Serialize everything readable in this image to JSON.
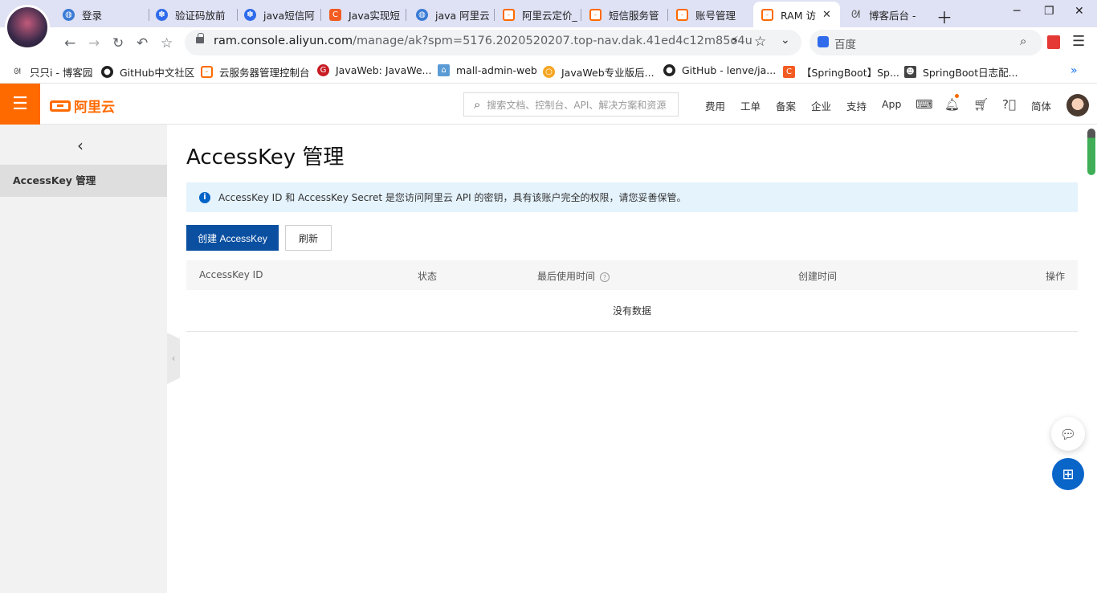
{
  "browser": {
    "tabs": [
      {
        "label": "登录",
        "icon": "globe-icon"
      },
      {
        "label": "验证码放前",
        "icon": "paw-icon"
      },
      {
        "label": "java短信阿",
        "icon": "paw-icon"
      },
      {
        "label": "Java实现短",
        "icon": "csdn-icon"
      },
      {
        "label": "java 阿里云",
        "icon": "globe-icon"
      },
      {
        "label": "阿里云定价_",
        "icon": "aliyun-icon"
      },
      {
        "label": "短信服务管",
        "icon": "aliyun-icon"
      },
      {
        "label": "账号管理",
        "icon": "aliyun-icon"
      },
      {
        "label": "RAM 访",
        "icon": "aliyun-icon"
      },
      {
        "label": "博客后台 - ",
        "icon": "cnblogs-icon"
      }
    ],
    "close_glyph": "✕",
    "url_host": "ram.console.aliyun.com",
    "url_path": "/manage/ak?spm=5176.2020520207.top-nav.dak.41ed4c12m85o4u",
    "search_engine": "百度",
    "bookmarks": [
      {
        "label": "只只i - 博客园",
        "icon": "cnblogs-icon"
      },
      {
        "label": "GitHub中文社区",
        "icon": "github-icon"
      },
      {
        "label": "云服务器管理控制台",
        "icon": "aliyun-icon"
      },
      {
        "label": "JavaWeb: JavaWe...",
        "icon": "gitee-icon"
      },
      {
        "label": "mall-admin-web",
        "icon": "store-icon"
      },
      {
        "label": "JavaWeb专业版后...",
        "icon": "circle-icon"
      },
      {
        "label": "GitHub - lenve/ja...",
        "icon": "github-icon"
      },
      {
        "label": "【SpringBoot】Sp...",
        "icon": "csdn-icon"
      },
      {
        "label": "SpringBoot日志配...",
        "icon": "person-icon"
      }
    ]
  },
  "header": {
    "logo_text": "阿里云",
    "search_placeholder": "搜索文档、控制台、API、解决方案和资源",
    "nav": [
      "费用",
      "工单",
      "备案",
      "企业",
      "支持",
      "App"
    ],
    "lang": "简体"
  },
  "sidebar": {
    "items": [
      {
        "label": "AccessKey 管理"
      }
    ]
  },
  "main": {
    "title": "AccessKey 管理",
    "notice": "AccessKey ID 和 AccessKey Secret 是您访问阿里云 API 的密钥，具有该账户完全的权限，请您妥善保管。",
    "create_button": "创建 AccessKey",
    "refresh_button": "刷新",
    "columns": [
      "AccessKey ID",
      "状态",
      "最后使用时间",
      "创建时间",
      "操作"
    ],
    "empty_text": "没有数据"
  },
  "colors": {
    "brand": "#ff6a00",
    "primary": "#0a4fa0",
    "notice_bg": "#e5f3fd"
  }
}
